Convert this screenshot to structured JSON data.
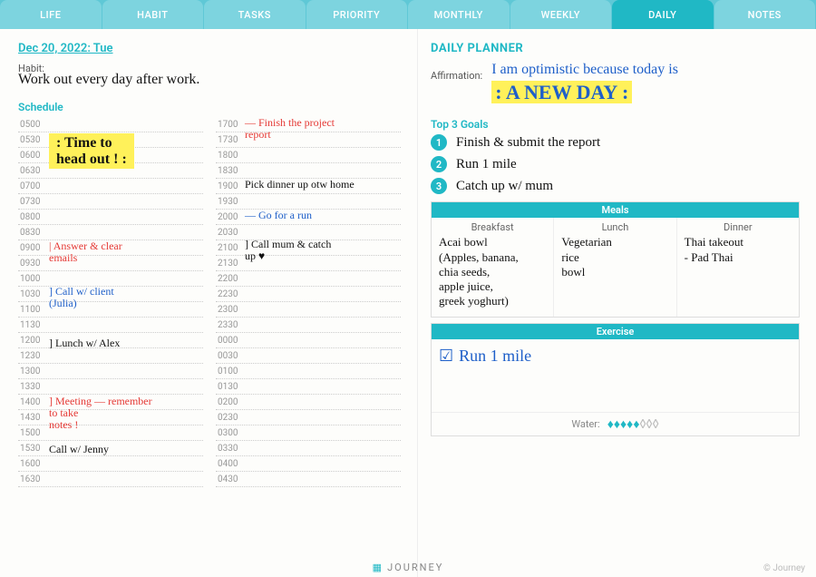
{
  "tabs": {
    "items": [
      "LIFE",
      "HABIT",
      "TASKS",
      "PRIORITY",
      "MONTHLY",
      "WEEKLY",
      "DAILY",
      "NOTES"
    ],
    "active": "DAILY"
  },
  "date": "Dec 20, 2022: Tue",
  "habit_label": "Habit:",
  "habit": "Work out every day after work.",
  "schedule_label": "Schedule",
  "times_col1": [
    "0500",
    "0530",
    "0600",
    "0630",
    "0700",
    "0730",
    "0800",
    "0830",
    "0900",
    "0930",
    "1000",
    "1030",
    "1100",
    "1130",
    "1200",
    "1230",
    "1300",
    "1330",
    "1400",
    "1430",
    "1500",
    "1530",
    "1600",
    "1630"
  ],
  "times_col2": [
    "1700",
    "1730",
    "1800",
    "1830",
    "1900",
    "1930",
    "2000",
    "2030",
    "2100",
    "2130",
    "2200",
    "2230",
    "2300",
    "2330",
    "0000",
    "0030",
    "0100",
    "0130",
    "0200",
    "0230",
    "0300",
    "0330",
    "0400",
    "0430"
  ],
  "sched": {
    "headout": ": Time to\n  head out ! :",
    "emails": "Answer & clear\n   emails",
    "client": "Call w/ client\n   (Julia)",
    "lunch": "Lunch w/ Alex",
    "meeting": "Meeting — remember\n   to take\n   notes !",
    "jenny": "Call w/ Jenny",
    "project": "— Finish the project\n    report",
    "dinner": "Pick dinner up otw home",
    "run": "— Go for a run",
    "mum": "Call mum & catch\n   up ♥"
  },
  "planner_title": "DAILY PLANNER",
  "affirm_label": "Affirmation:",
  "affirm_line1": "I am optimistic because today is",
  "affirm_line2": ": A NEW DAY :",
  "goals_label": "Top 3 Goals",
  "goals": [
    "Finish & submit the report",
    "Run 1 mile",
    "Catch up w/ mum"
  ],
  "meals_label": "Meals",
  "meals": {
    "breakfast": {
      "label": "Breakfast",
      "text": "Acai bowl\n(Apples, banana,\nchia seeds,\napple juice,\ngreek yoghurt)"
    },
    "lunch": {
      "label": "Lunch",
      "text": "Vegetarian\nrice\nbowl"
    },
    "dinner": {
      "label": "Dinner",
      "text": "Thai takeout\n- Pad Thai"
    }
  },
  "exercise_label": "Exercise",
  "exercise": "Run 1 mile",
  "water_label": "Water:",
  "water_total": 8,
  "water_filled": 5,
  "footer": "JOURNEY",
  "credit": "© Journey"
}
